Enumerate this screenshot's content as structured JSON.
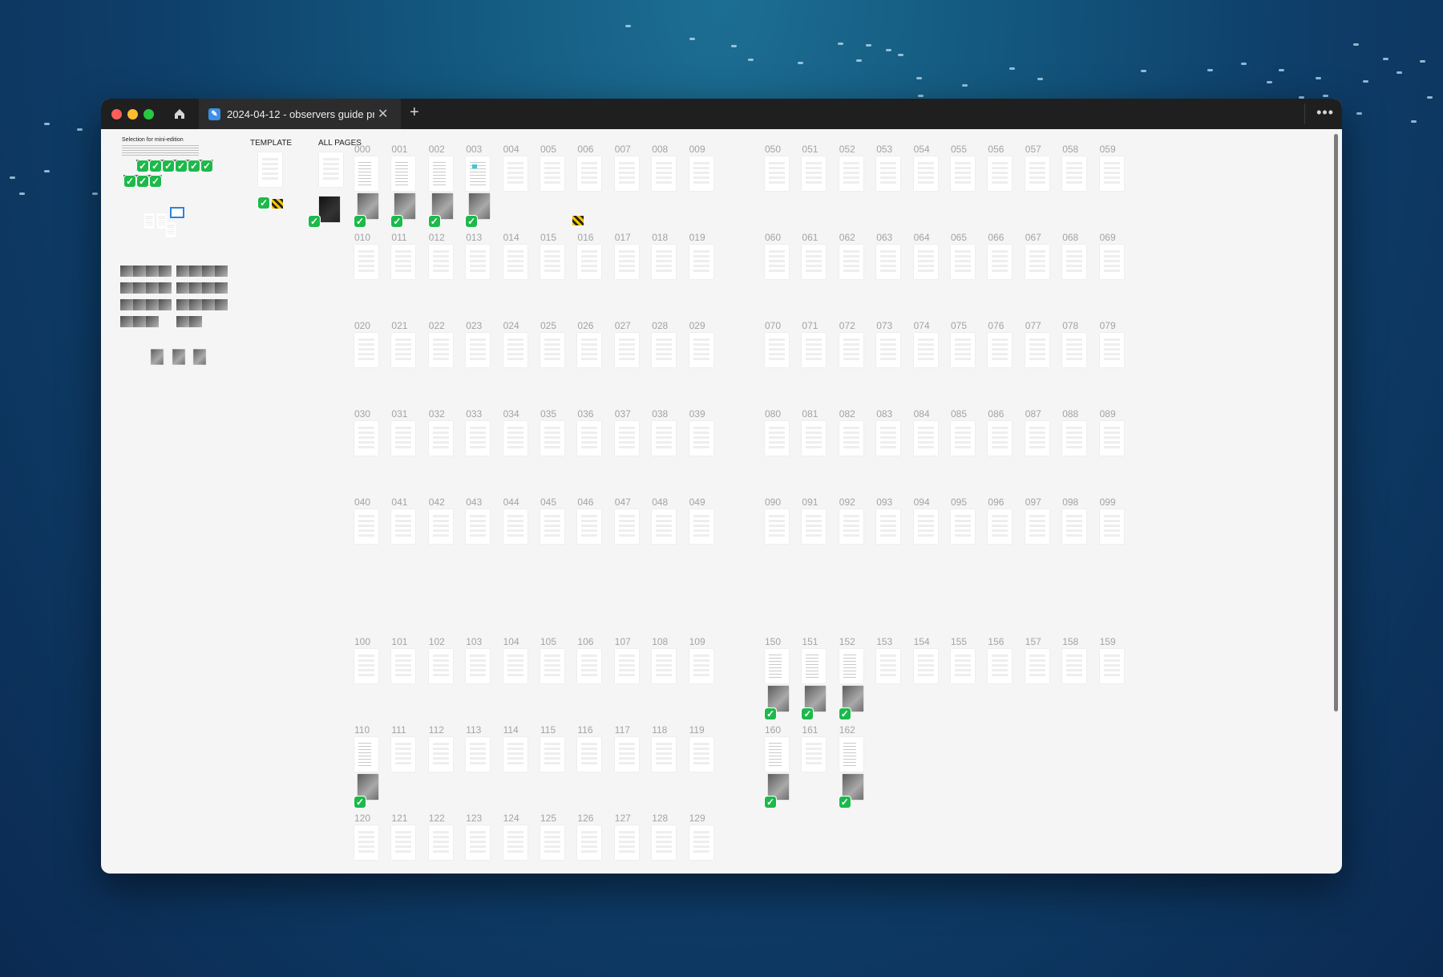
{
  "window": {
    "tab_title": "2024-04-12 - observers guide pr",
    "new_tab": "+",
    "more": "•••",
    "tab_close": "✕"
  },
  "sections": {
    "selection": "Selection for mini-edition",
    "template": "TEMPLATE",
    "all_pages": "ALL PAGES"
  },
  "icons": {
    "home": "home-icon",
    "check": "✓",
    "figma": "figma-icon"
  },
  "colors": {
    "check": "#1db94b",
    "accent": "#3b8fe6"
  },
  "page_blocks": [
    {
      "start": 0,
      "checked": [
        0,
        1,
        2,
        3
      ]
    },
    {
      "start": 10
    },
    {
      "start": 20
    },
    {
      "start": 30
    },
    {
      "start": 40
    },
    {
      "start": 50
    },
    {
      "start": 60
    },
    {
      "start": 70
    },
    {
      "start": 80
    },
    {
      "start": 90
    },
    {
      "start": 100
    },
    {
      "start": 110,
      "checked": [
        0
      ]
    },
    {
      "start": 120
    },
    {
      "start": 150,
      "checked": [
        0,
        1,
        2
      ]
    },
    {
      "start": 160,
      "count": 3,
      "checked": [
        0,
        2
      ]
    }
  ]
}
